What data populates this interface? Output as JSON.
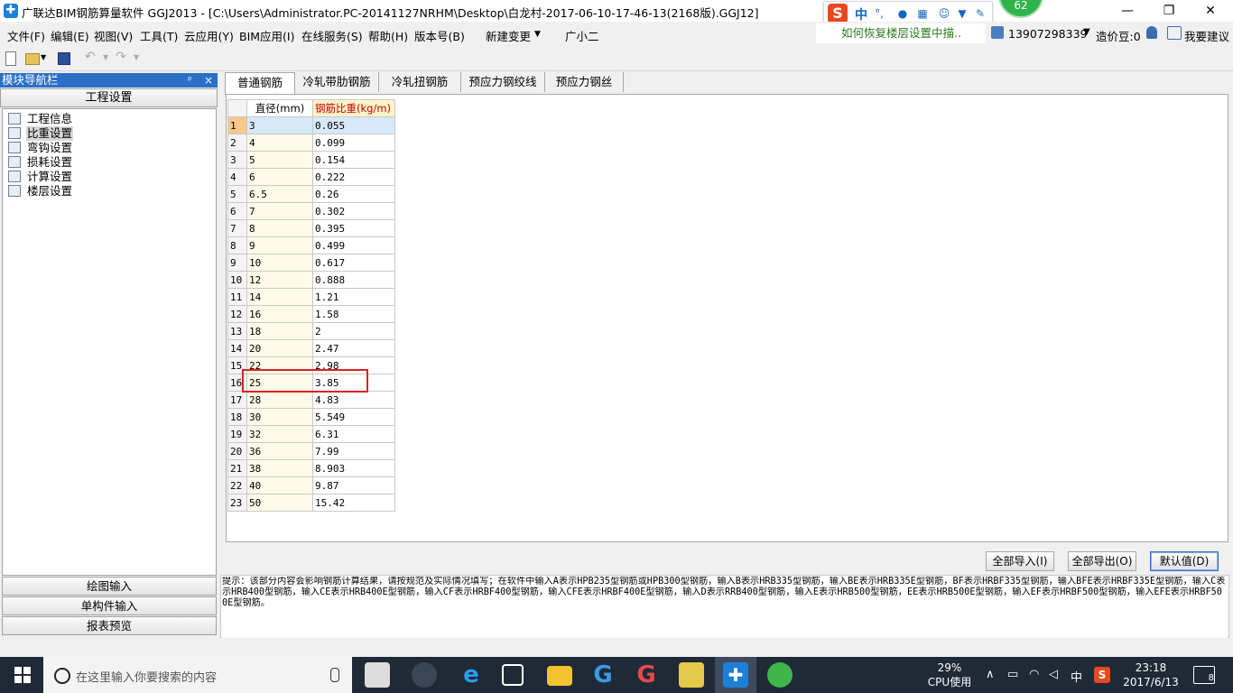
{
  "window": {
    "title": "广联达BIM钢筋算量软件 GGJ2013 - [C:\\Users\\Administrator.PC-20141127NRHM\\Desktop\\白龙村-2017-06-10-17-46-13(2168版).GGJ12]",
    "badge": "62",
    "ime_logo": "S",
    "ime_mode": "中",
    "ime_punct": "°,"
  },
  "menu": {
    "items": [
      "文件(F)",
      "编辑(E)",
      "视图(V)",
      "工具(T)",
      "云应用(Y)",
      "BIM应用(I)",
      "在线服务(S)",
      "帮助(H)",
      "版本号(B)",
      "新建变更",
      "广小二"
    ],
    "notice": "如何恢复楼层设置中描..",
    "user_phone": "13907298339",
    "coin_label": "造价豆:0",
    "suggest": "我要建议"
  },
  "nav": {
    "title": "模块导航栏",
    "pin": "ᵖ",
    "close": "×",
    "section": "工程设置",
    "items": [
      "工程信息",
      "比重设置",
      "弯钩设置",
      "损耗设置",
      "计算设置",
      "楼层设置"
    ],
    "selected_index": 1,
    "bottom": [
      "绘图输入",
      "单构件输入",
      "报表预览"
    ]
  },
  "tabs": [
    "普通钢筋",
    "冷轧带肋钢筋",
    "冷轧扭钢筋",
    "预应力钢绞线",
    "预应力钢丝"
  ],
  "grid": {
    "headers": [
      "直径(mm)",
      "钢筋比重(kg/m)"
    ],
    "rows": [
      [
        "1",
        "3",
        "0.055"
      ],
      [
        "2",
        "4",
        "0.099"
      ],
      [
        "3",
        "5",
        "0.154"
      ],
      [
        "4",
        "6",
        "0.222"
      ],
      [
        "5",
        "6.5",
        "0.26"
      ],
      [
        "6",
        "7",
        "0.302"
      ],
      [
        "7",
        "8",
        "0.395"
      ],
      [
        "8",
        "9",
        "0.499"
      ],
      [
        "9",
        "10",
        "0.617"
      ],
      [
        "10",
        "12",
        "0.888"
      ],
      [
        "11",
        "14",
        "1.21"
      ],
      [
        "12",
        "16",
        "1.58"
      ],
      [
        "13",
        "18",
        "2"
      ],
      [
        "14",
        "20",
        "2.47"
      ],
      [
        "15",
        "22",
        "2.98"
      ],
      [
        "16",
        "25",
        "3.85"
      ],
      [
        "17",
        "28",
        "4.83"
      ],
      [
        "18",
        "30",
        "5.549"
      ],
      [
        "19",
        "32",
        "6.31"
      ],
      [
        "20",
        "36",
        "7.99"
      ],
      [
        "21",
        "38",
        "8.903"
      ],
      [
        "22",
        "40",
        "9.87"
      ],
      [
        "23",
        "50",
        "15.42"
      ]
    ],
    "selected_row": 0
  },
  "buttons": {
    "import_all": "全部导入(I)",
    "export_all": "全部导出(O)",
    "default": "默认值(D)"
  },
  "hint": "提示：该部分内容会影响钢筋计算结果，请按规范及实际情况填写；在软件中输入A表示HPB235型钢筋或HPB300型钢筋，输入B表示HRB335型钢筋，输入BE表示HRB335E型钢筋，BF表示HRBF335型钢筋，输入BFE表示HRBF335E型钢筋，输入C表示HRB400型钢筋，输入CE表示HRB400E型钢筋，输入CF表示HRBF400型钢筋，输入CFE表示HRBF400E型钢筋，输入D表示RRB400型钢筋，输入E表示HRB500型钢筋，EE表示HRB500E型钢筋，输入EF表示HRBF500型钢筋，输入EFE表示HRBF500E型钢筋。",
  "taskbar": {
    "search_placeholder": "在这里输入你要搜索的内容",
    "cpu_percent": "29%",
    "cpu_label": "CPU使用",
    "ime": "中",
    "ime_logo": "S",
    "time": "23:18",
    "date": "2017/6/13",
    "notifications": "8"
  },
  "colors": {
    "nav_title": "#2b6fc7",
    "weight_header": "#c00000",
    "highlight": "#e02020",
    "notice_text": "#2a7a1e"
  }
}
